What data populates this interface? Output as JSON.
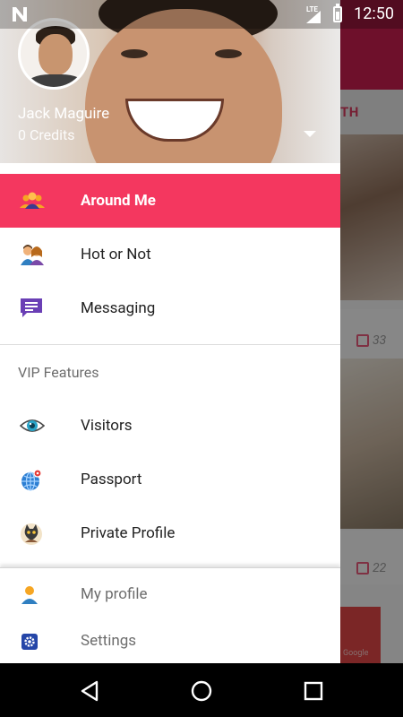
{
  "status_bar": {
    "time": "12:50",
    "network": "LTE"
  },
  "background_screen": {
    "tab_label": "TH",
    "card_counts": [
      "33",
      "22"
    ],
    "ad_text": "Google"
  },
  "drawer": {
    "user": {
      "name": "Jack Maguire",
      "credits": "0 Credits"
    },
    "menu": [
      {
        "label": "Around Me",
        "icon": "people-icon",
        "active": true
      },
      {
        "label": "Hot or Not",
        "icon": "couple-icon",
        "active": false
      },
      {
        "label": "Messaging",
        "icon": "chat-icon",
        "active": false
      }
    ],
    "vip_section": {
      "title": "VIP Features",
      "items": [
        {
          "label": "Visitors",
          "icon": "eye-icon"
        },
        {
          "label": "Passport",
          "icon": "globe-icon"
        },
        {
          "label": "Private Profile",
          "icon": "cat-mask-icon"
        }
      ]
    },
    "bottom": [
      {
        "label": "My profile",
        "icon": "person-icon"
      },
      {
        "label": "Settings",
        "icon": "gear-icon"
      }
    ]
  },
  "colors": {
    "accent": "#f4375f",
    "toolbar": "#c81e4f"
  }
}
